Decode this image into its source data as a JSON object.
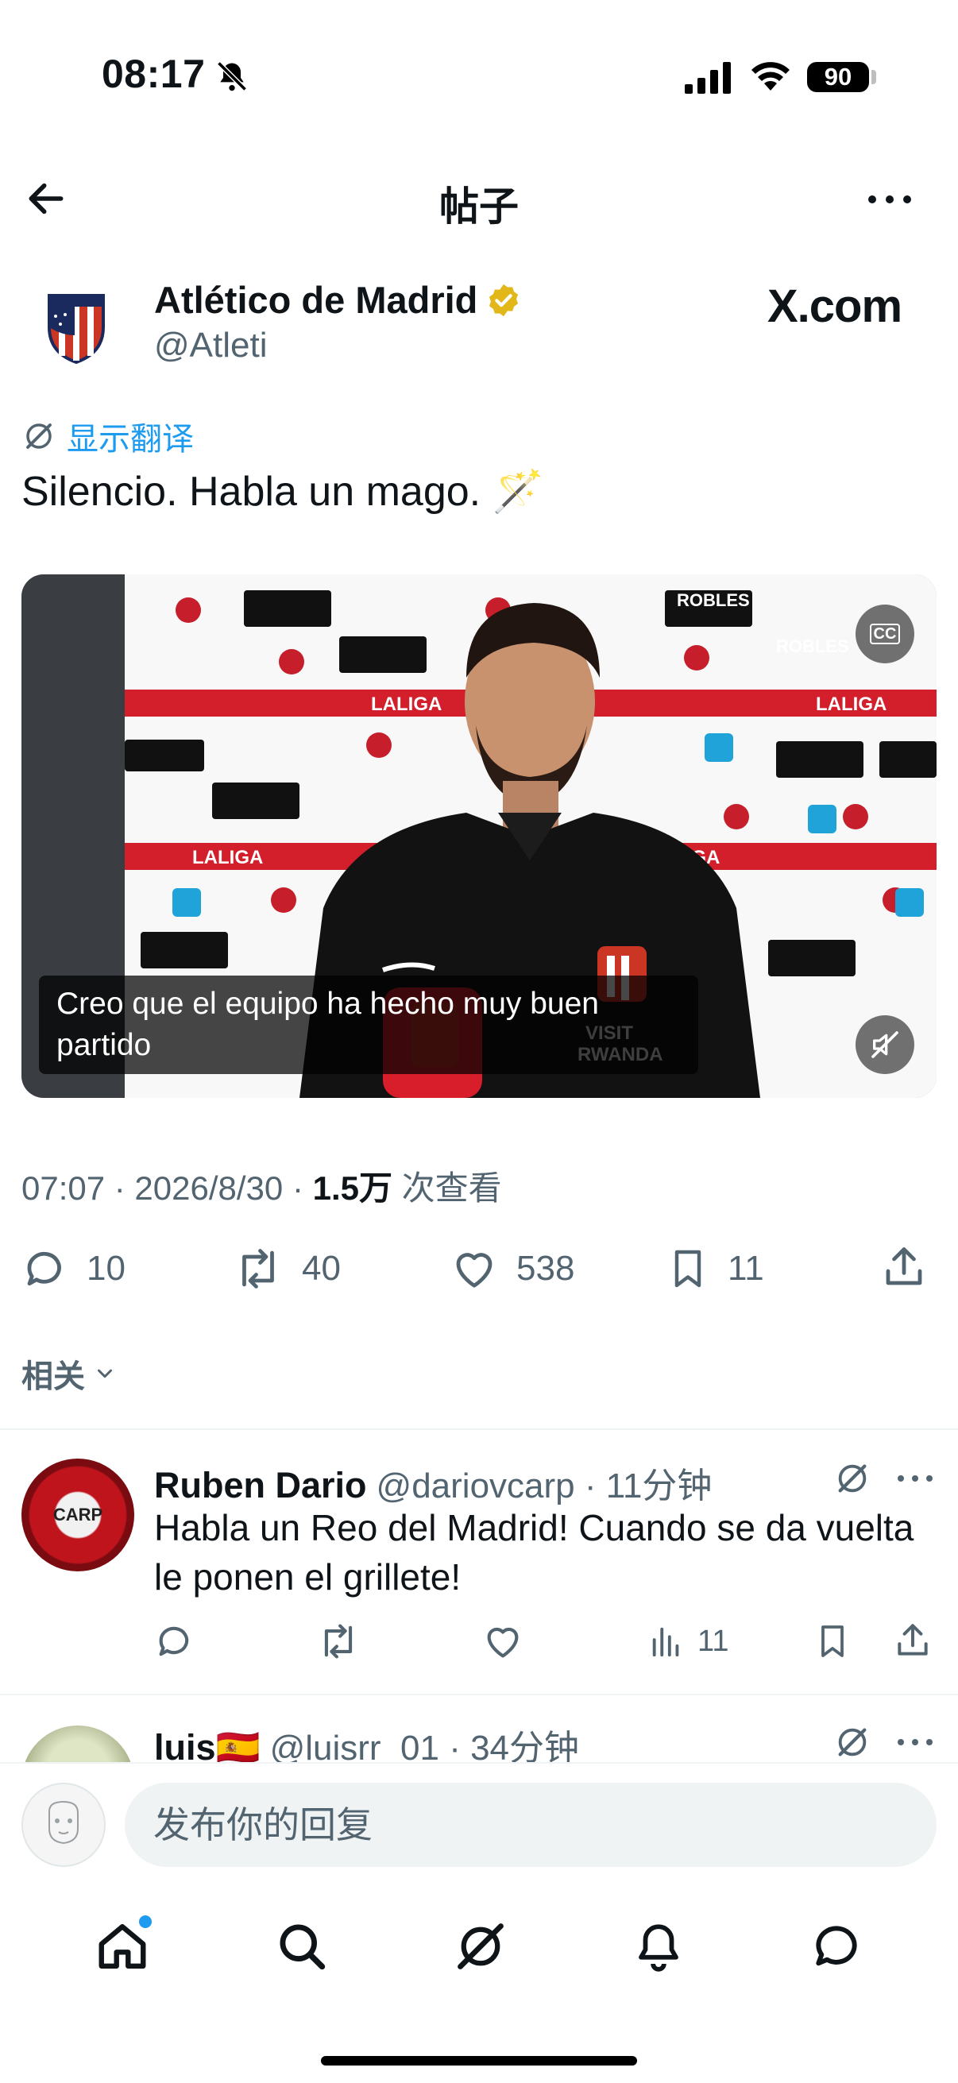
{
  "status_bar": {
    "time": "08:17",
    "battery": "90"
  },
  "nav": {
    "title": "帖子"
  },
  "post": {
    "author_name": "Atlético de Madrid",
    "author_handle": "@Atleti",
    "brand": "X.com",
    "translate_label": "显示翻译",
    "text": "Silencio. Habla un mago. 🪄",
    "video": {
      "caption": "Creo que el equipo ha hecho muy buen partido",
      "cc_label": "CC"
    },
    "meta_time": "07:07 · 2026/8/30 · ",
    "meta_views": "1.5万",
    "meta_views_label": " 次查看",
    "replies": "10",
    "reposts": "40",
    "likes": "538",
    "bookmarks": "11"
  },
  "related_label": "相关",
  "replies": [
    {
      "name": "Ruben Dario",
      "handle": "@dariovcarp · 11分钟",
      "text": "Habla un Reo del Madrid! Cuando se da vuelta le ponen el grillete!",
      "views": "11",
      "avatar_text": "CARP"
    },
    {
      "name": "luis🇪🇸",
      "handle": "@luisrr_01 · 34分钟"
    }
  ],
  "composer": {
    "placeholder": "发布你的回复"
  },
  "colors": {
    "accent": "#1d9bf0",
    "text": "#0f1419",
    "muted": "#536471",
    "verified": "#e2b719"
  }
}
